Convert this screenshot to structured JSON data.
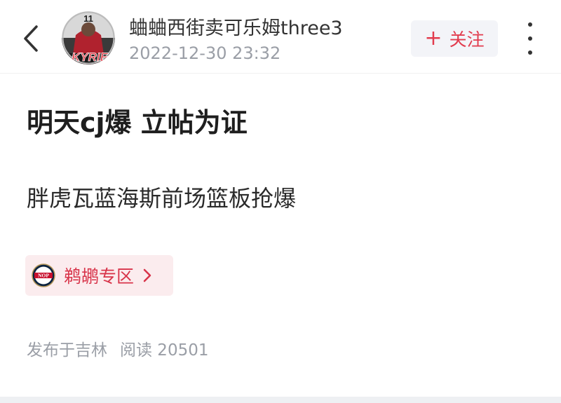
{
  "header": {
    "username": "蛐蛐西街卖可乐姆three3",
    "timestamp": "2022-12-30 23:32",
    "follow_label": "关注",
    "follow_icon": "plus-icon",
    "back_icon": "chevron-left-icon",
    "more_icon": "more-vertical-icon",
    "avatar_jersey_number": "11",
    "avatar_text": "KYRIE"
  },
  "post": {
    "title": "明天cj爆 立帖为证",
    "body": "胖虎瓦蓝海斯前场篮板抢爆"
  },
  "zone": {
    "label": "鹈鹕专区",
    "logo_text": "NOP",
    "logo_icon": "pelicans-logo",
    "chevron_icon": "chevron-right-icon"
  },
  "meta": {
    "location": "发布于吉林",
    "reads": "阅读 20501"
  },
  "colors": {
    "accent": "#e23c4e",
    "zone_bg": "#fbecee",
    "follow_bg": "#f3f4f8",
    "muted_text": "#9a9ea6"
  }
}
